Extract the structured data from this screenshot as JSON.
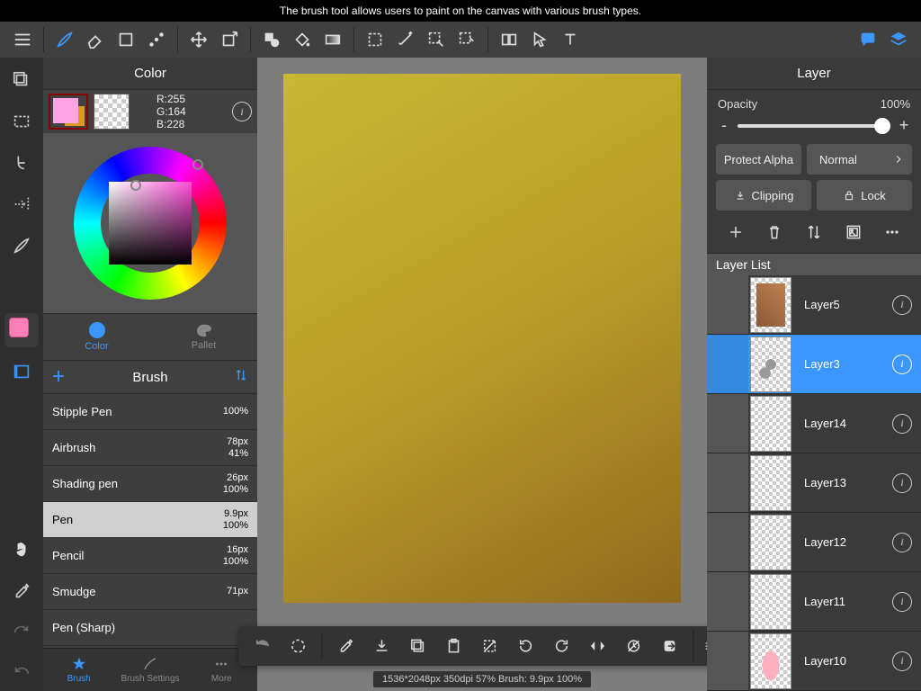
{
  "tooltip": "The brush tool allows users to paint on the canvas with various brush types.",
  "colorPanel": {
    "title": "Color",
    "rgb": {
      "r": "R:255",
      "g": "G:164",
      "b": "B:228"
    },
    "tabs": {
      "color": "Color",
      "pallet": "Pallet"
    }
  },
  "brushPanel": {
    "title": "Brush",
    "brushes": [
      {
        "name": "Stipple Pen",
        "size": "",
        "opacity": "100%"
      },
      {
        "name": "Airbrush",
        "size": "78px",
        "opacity": "41%"
      },
      {
        "name": "Shading pen",
        "size": "26px",
        "opacity": "100%"
      },
      {
        "name": "Pen",
        "size": "9.9px",
        "opacity": "100%"
      },
      {
        "name": "Pencil",
        "size": "16px",
        "opacity": "100%"
      },
      {
        "name": "Smudge",
        "size": "71px",
        "opacity": ""
      },
      {
        "name": "Pen (Sharp)",
        "size": "",
        "opacity": ""
      }
    ],
    "bottomTabs": {
      "brush": "Brush",
      "settings": "Brush Settings",
      "more": "More"
    }
  },
  "layerPanel": {
    "title": "Layer",
    "opacityLabel": "Opacity",
    "opacityValue": "100%",
    "protectAlpha": "Protect Alpha",
    "blendMode": "Normal",
    "clipping": "Clipping",
    "lock": "Lock",
    "listHeader": "Layer List",
    "layers": [
      {
        "name": "Layer5"
      },
      {
        "name": "Layer3"
      },
      {
        "name": "Layer14"
      },
      {
        "name": "Layer13"
      },
      {
        "name": "Layer12"
      },
      {
        "name": "Layer11"
      },
      {
        "name": "Layer10"
      }
    ]
  },
  "status": "1536*2048px 350dpi 57% Brush: 9.9px 100%"
}
